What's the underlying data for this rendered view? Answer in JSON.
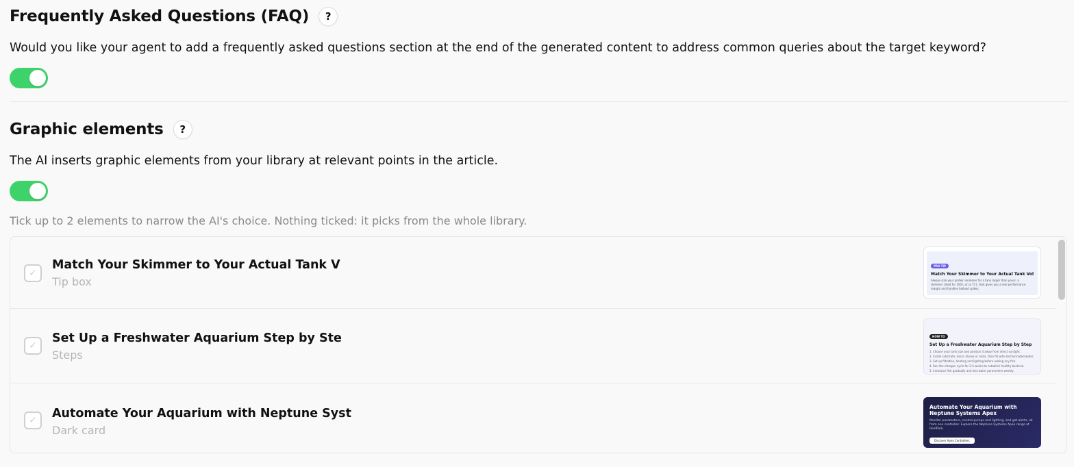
{
  "faq": {
    "title": "Frequently Asked Questions (FAQ)",
    "help": "?",
    "description": "Would you like your agent to add a frequently asked questions section at the end of the generated content to address common queries about the target keyword?",
    "enabled": true
  },
  "graphics": {
    "title": "Graphic elements",
    "help": "?",
    "description": "The AI inserts graphic elements from your library at relevant points in the article.",
    "enabled": true,
    "hint": "Tick up to 2 elements to narrow the AI's choice. Nothing ticked: it picks from the whole library."
  },
  "items": [
    {
      "title": "Match Your Skimmer to Your Actual Tank V",
      "type": "Tip box",
      "checked": false,
      "preview": {
        "badge": "PRO TIP",
        "title": "Match Your Skimmer to Your Actual Tank Volume",
        "lines": [
          "Always size your protein skimmer for a tank larger than yours; a",
          "skimmer rated for 100 L on a 75 L tank gives you a real performance",
          "margin and handles bioload spikes."
        ]
      }
    },
    {
      "title": "Set Up a Freshwater Aquarium Step by Ste",
      "type": "Steps",
      "checked": false,
      "preview": {
        "badge": "HOW TO",
        "title": "Set Up a Freshwater Aquarium Step by Step",
        "steps": [
          "1. Choose your tank size and position it away from direct sunlight.",
          "2. Install substrate, decor stones or roots, then fill with dechlorinated water.",
          "3. Set up filtration, heating and lighting before adding any fish.",
          "4. Run the nitrogen cycle for 2-4 weeks to establish healthy bacteria.",
          "5. Introduce fish gradually and test water parameters weekly."
        ]
      }
    },
    {
      "title": "Automate Your Aquarium with Neptune Syst",
      "type": "Dark card",
      "checked": false,
      "preview": {
        "title": "Automate Your Aquarium with Neptune Systems Apex",
        "text": "Monitor parameters, control pumps and lighting, and get alerts, all from one controller. Explore the Neptune Systems Apex range at ReefPark.",
        "button": "Discover Apex Controllers"
      }
    }
  ],
  "colors": {
    "toggle_on": "#3ed36a",
    "badge_purple": "#6b5ce7",
    "badge_dark": "#222222",
    "dark_card": "#1d1f44"
  }
}
